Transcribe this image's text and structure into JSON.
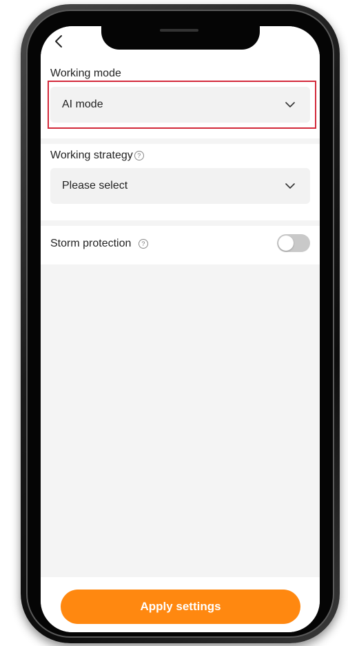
{
  "nav": {
    "back_icon": "chevron-left-icon"
  },
  "working_mode": {
    "label": "Working mode",
    "selected_value": "AI mode",
    "chevron_icon": "chevron-down-icon"
  },
  "working_strategy": {
    "label": "Working strategy",
    "placeholder": "Please select",
    "help_icon": "question-circle-icon",
    "chevron_icon": "chevron-down-icon"
  },
  "storm_protection": {
    "label": "Storm protection",
    "help_icon": "question-circle-icon",
    "enabled": false
  },
  "footer": {
    "apply_label": "Apply settings"
  },
  "colors": {
    "accent": "#ff8810",
    "highlight": "#d3283a",
    "background": "#f4f4f4",
    "toggle_off": "#c9c9c9"
  }
}
